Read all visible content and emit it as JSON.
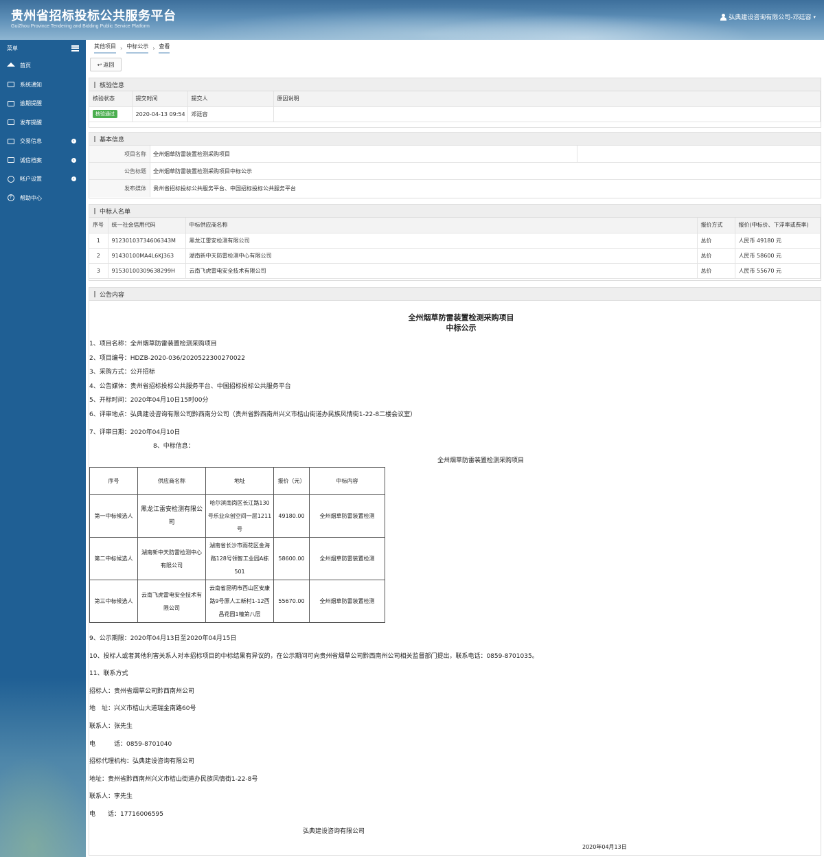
{
  "header": {
    "title": "贵州省招标投标公共服务平台",
    "subtitle": "GuiZhou Province Tendering and Bidding Public Service Platform",
    "user": "弘典建设咨询有限公司-邓廷容"
  },
  "sidebar": {
    "menu_label": "菜单",
    "items": [
      {
        "label": "首页",
        "icon": "home-icon"
      },
      {
        "label": "系统通知",
        "icon": "monitor-icon"
      },
      {
        "label": "逾期提醒",
        "icon": "folder-icon"
      },
      {
        "label": "发布提醒",
        "icon": "folder-icon"
      },
      {
        "label": "交易信息",
        "icon": "folder-icon"
      },
      {
        "label": "诚信档案",
        "icon": "list-icon"
      },
      {
        "label": "帐户设置",
        "icon": "user-icon"
      },
      {
        "label": "帮助中心",
        "icon": "help-icon"
      }
    ]
  },
  "breadcrumb": [
    "其他项目",
    "中标公示",
    "查看"
  ],
  "back_label": "返回",
  "verify": {
    "title": "核验信息",
    "headers": [
      "核验状态",
      "提交时间",
      "提交人",
      "原因说明"
    ],
    "status": "核验通过",
    "time": "2020-04-13 09:54",
    "submitter": "邓廷容",
    "reason": ""
  },
  "basic": {
    "title": "基本信息",
    "rows": [
      {
        "label": "项目名称",
        "value": "全州烟草防雷装置检测采购项目"
      },
      {
        "label": "公告标题",
        "value": "全州烟草防雷装置检测采购项目中标公示"
      },
      {
        "label": "发布媒体",
        "value": "贵州省招标投标公共服务平台、中国招标投标公共服务平台"
      }
    ]
  },
  "winners": {
    "title": "中标人名单",
    "headers": [
      "序号",
      "统一社会信用代码",
      "中标供应商名称",
      "报价方式",
      "报价(中标价、下浮率或费率)"
    ],
    "rows": [
      {
        "no": "1",
        "code": "91230103734606343M",
        "name": "黑龙江雷安检测有限公司",
        "method": "总价",
        "price": "人民币 49180 元"
      },
      {
        "no": "2",
        "code": "91430100MA4L6KJ363",
        "name": "湖南新中天防雷检测中心有限公司",
        "method": "总价",
        "price": "人民币 58600 元"
      },
      {
        "no": "3",
        "code": "915301003096382​99H",
        "name": "云南飞虎雷电安全技术有限公司",
        "method": "总价",
        "price": "人民币 55670 元"
      }
    ]
  },
  "notice": {
    "title": "公告内容",
    "heading1": "全州烟草防雷装置检测采购项目",
    "heading2": "中标公示",
    "lines": [
      "1、项目名称：全州烟草防雷装置检测采购项目",
      "2、项目编号：HDZB-2020-036/2020522300270022",
      "3、采购方式：公开招标",
      "4、公告媒体：贵州省招标投标公共服务平台、中国招标投标公共服务平台",
      "5、开标时间：2020年04月10日15时00分",
      "6、评审地点：弘典建设咨询有限公司黔西南分公司（贵州省黔西南州兴义市桔山街道办民族风情街1-22-8二楼会议室）",
      "7、评审日期：2020年04月10日"
    ],
    "line8": "8、中标信息：",
    "table_caption": "全州烟草防雷装置检测采购项目",
    "award_headers": [
      "序号",
      "供应商名称",
      "地址",
      "报价（元）",
      "中标内容"
    ],
    "award_rows": [
      {
        "rank": "第一中标候选人",
        "name": "黑龙江雷安检测有限公司",
        "addr": "哈尔滨南岗区长江路130号乐业众创空间一层1211号",
        "price": "49180.00",
        "content": "全州烟草防雷装置检测"
      },
      {
        "rank": "第二中标候选人",
        "name": "湖南新中天防雷检测中心有限公司",
        "addr": "湖南省长沙市雨花区金海路128号领智工业园A栋501",
        "price": "58600.00",
        "content": "全州烟草防雷装置检测"
      },
      {
        "rank": "第三中标候选人",
        "name": "云南飞虎雷电安全技术有限公司",
        "addr": "云南省昆明市西山区安康路9号原人工新村1-12西昌花园1幢第八层",
        "price": "55670.00",
        "content": "全州烟草防雷装置检测"
      }
    ],
    "lines2": [
      "9、公示期限：2020年04月13日至2020年04月15日",
      "10、投标人或者其他利害关系人对本招标项目的中标结果有异议的，在公示期间可向贵州省烟草公司黔西南州公司相关监督部门提出，联系电话：0859-8701035。",
      "11、联系方式",
      "招标人：贵州省烟草公司黔西南州公司",
      "地　址：兴义市桔山大道瑞金南路60号",
      "联系人：张先生",
      "电　　　话：0859-8701040",
      "招标代理机构：弘典建设咨询有限公司",
      "地址：贵州省黔西南州兴义市桔山街道办民族风情街1-22-8号",
      "联系人：李先生",
      "电　　话：17716006595"
    ],
    "signature": "弘典建设咨询有限公司",
    "date": "2020年04月13日"
  }
}
